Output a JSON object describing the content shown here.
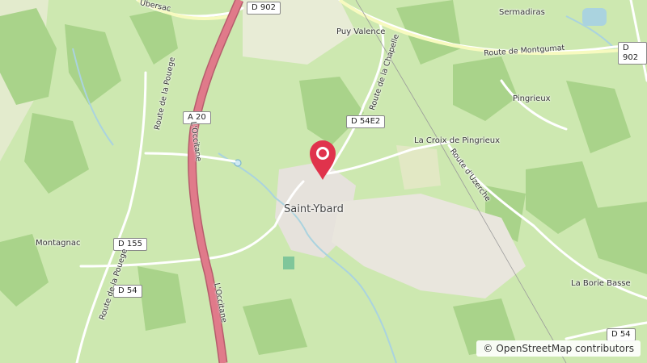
{
  "map": {
    "places": {
      "saint_ybard": "Saint-Ybard",
      "puy_valence": "Puy Valence",
      "sermadiras": "Sermadiras",
      "pingrieux": "Pingrieux",
      "croix_pingrieux": "La Croix de Pingrieux",
      "montagnac": "Montagnac",
      "borie_basse": "La Borie Basse"
    },
    "roads": {
      "d902_top": "D 902",
      "d902_right": "D 902",
      "a20": "A 20",
      "d54e2": "D 54E2",
      "d155": "D 155",
      "d54_left": "D 54",
      "d54_bottom": "D 54",
      "route_montgumat": "Route de Montgumat",
      "route_chapelle": "Route de la Chapelle",
      "route_pouege_top": "Route de la Pouege",
      "route_pouege_bottom": "Route de la Pouege",
      "occitane_top": "L'Occitane",
      "occitane_bottom": "L'Occitane",
      "route_uzerche": "Route d'Uzerche",
      "ubersac": "Ubersac"
    },
    "colors": {
      "meadow": "#cde8b0",
      "forest": "#a9d38a",
      "urban": "#e6e2dc",
      "motorway": "#e07a8a",
      "road": "#ffffff",
      "water": "#aad3df",
      "marker": "#e0334c"
    }
  },
  "attribution": {
    "symbol": "©",
    "text": "OpenStreetMap contributors"
  }
}
